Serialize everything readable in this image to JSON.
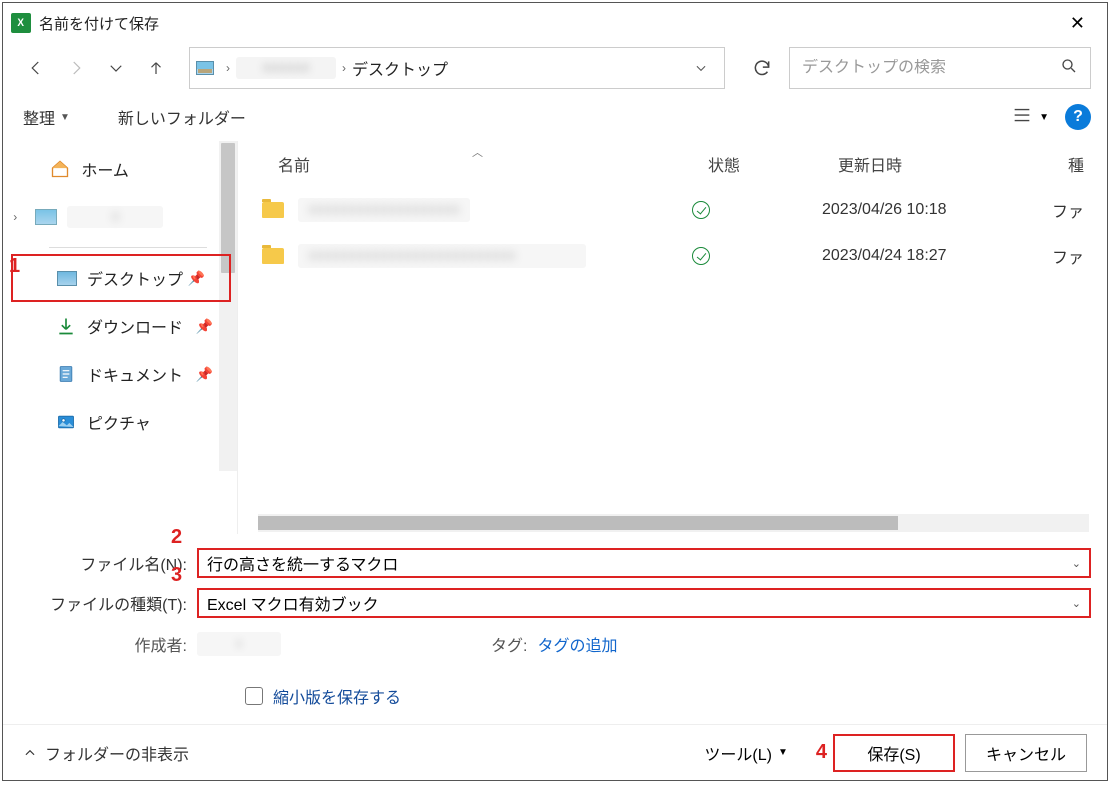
{
  "title": "名前を付けて保存",
  "app_badge": "X",
  "nav": {
    "current_loc": "デスクトップ"
  },
  "search": {
    "placeholder": "デスクトップの検索"
  },
  "toolbar": {
    "organize": "整理",
    "new_folder": "新しいフォルダー"
  },
  "sidebar": {
    "home": "ホーム",
    "desktop": "デスクトップ",
    "downloads": "ダウンロード",
    "documents": "ドキュメント",
    "pictures": "ピクチャ"
  },
  "columns": {
    "name": "名前",
    "state": "状態",
    "date": "更新日時",
    "type": "種"
  },
  "rows": [
    {
      "date": "2023/04/26 10:18",
      "type": "ファ"
    },
    {
      "date": "2023/04/24 18:27",
      "type": "ファ"
    }
  ],
  "form": {
    "filename_label": "ファイル名(N):",
    "filename_value": "行の高さを統一するマクロ",
    "filetype_label": "ファイルの種類(T):",
    "filetype_value": "Excel マクロ有効ブック",
    "author_label": "作成者:",
    "tag_label": "タグ:",
    "tag_value": "タグの追加",
    "thumb_label": "縮小版を保存する"
  },
  "footer": {
    "hide_folders": "フォルダーの非表示",
    "tools": "ツール(L)",
    "save": "保存(S)",
    "cancel": "キャンセル"
  },
  "annotations": {
    "a1": "1",
    "a2": "2",
    "a3": "3",
    "a4": "4"
  }
}
